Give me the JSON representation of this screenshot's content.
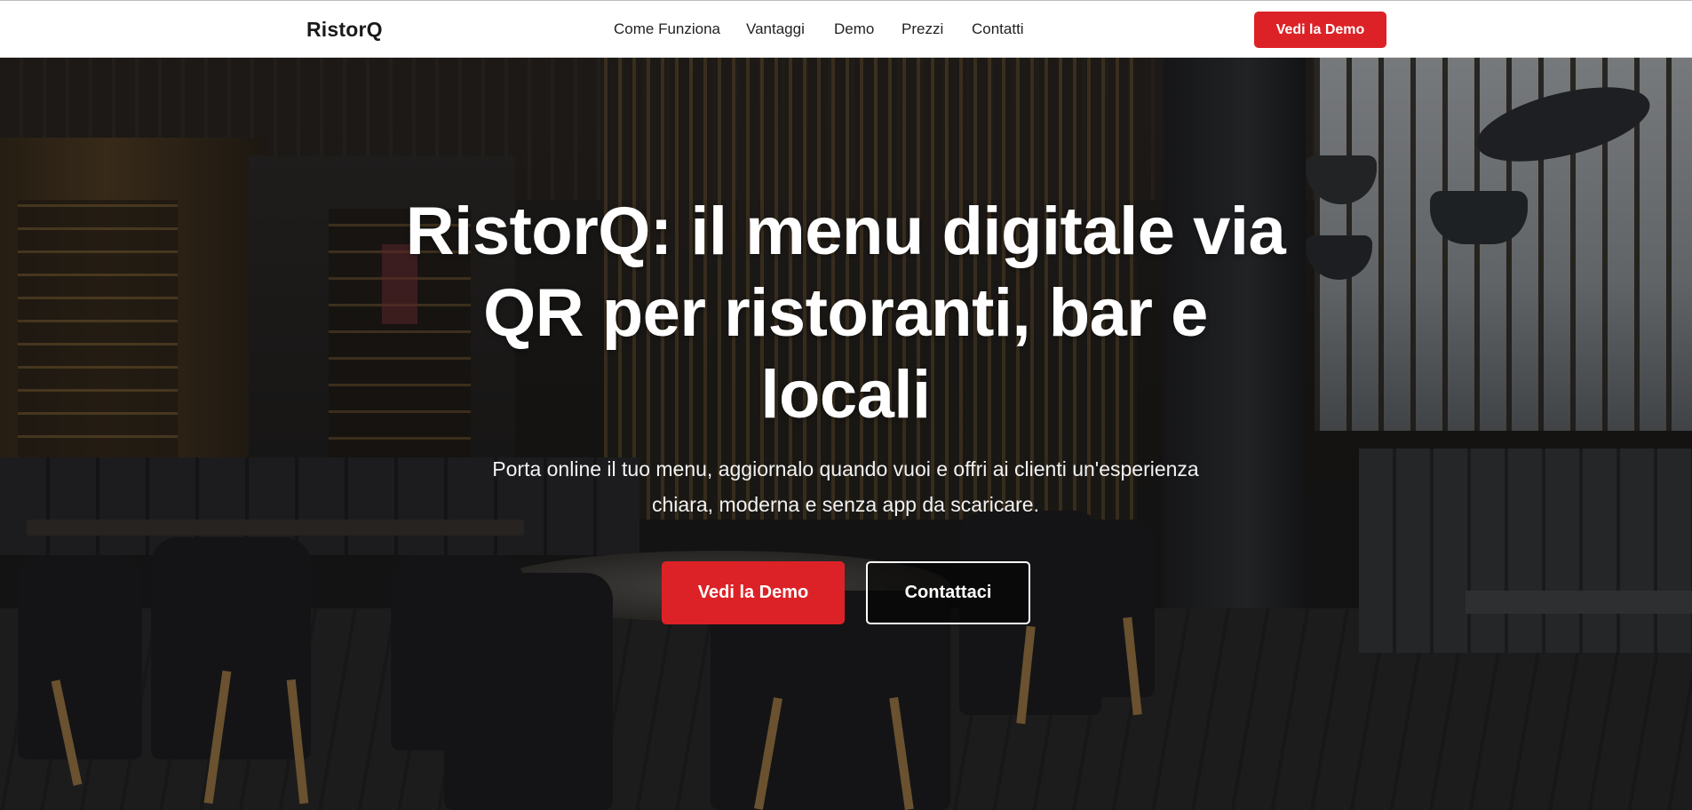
{
  "header": {
    "brand": "RistorQ",
    "nav": [
      "Come Funziona",
      "Vantaggi",
      "Demo",
      "Prezzi",
      "Contatti"
    ],
    "cta_label": "Vedi la Demo"
  },
  "hero": {
    "title": "RistorQ: il menu digitale via QR per ristoranti, bar e locali",
    "subtitle": "Porta online il tuo menu, aggiornalo quando vuoi e offri ai clienti un'esperienza chiara, moderna e senza app da scaricare.",
    "primary_button": "Vedi la Demo",
    "secondary_button": "Contattaci",
    "background_image": "restaurant-interior-photo"
  },
  "colors": {
    "accent": "#dd2227",
    "header_bg": "#ffffff",
    "text_dark": "#1a1a1a",
    "hero_text": "#ffffff"
  }
}
